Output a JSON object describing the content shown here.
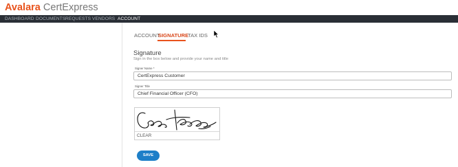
{
  "brand": {
    "name_part1": "Avalara",
    "name_part2": "CertExpress"
  },
  "nav": {
    "items": [
      "DASHBOARD",
      "DOCUMENTS",
      "REQUESTS",
      "VENDORS",
      "ACCOUNT"
    ],
    "active": "ACCOUNT"
  },
  "tabs": {
    "items": [
      "ACCOUNT",
      "SIGNATURE",
      "TAX IDS"
    ],
    "active": "SIGNATURE"
  },
  "signature": {
    "title": "Signature",
    "subtitle": "Sign in the box below and provide your name and title",
    "name_label": "Signer Name *",
    "name_value": "CertExpress Customer",
    "title_label": "Signer Title",
    "title_value": "Chief Financial Officer (CFO)",
    "clear_label": "CLEAR",
    "save_label": "SAVE"
  },
  "colors": {
    "accent": "#e8531d",
    "nav_bg": "#2a2f36",
    "button": "#1e7fc8"
  }
}
